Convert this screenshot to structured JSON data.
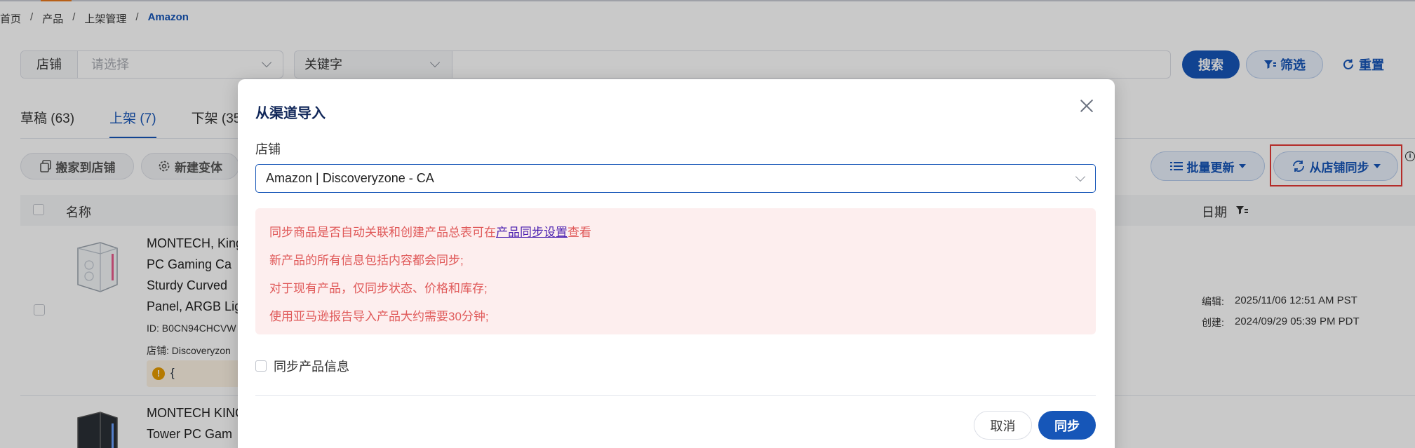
{
  "breadcrumb": [
    "首页",
    "产品",
    "上架管理",
    "Amazon"
  ],
  "filters": {
    "store_label": "店铺",
    "store_placeholder": "请选择",
    "keyword_label": "关键字",
    "search_button": "搜索",
    "filter_button": "筛选",
    "reset_button": "重置"
  },
  "tabs": [
    {
      "label": "草稿 (63)"
    },
    {
      "label": "上架 (7)",
      "active": true
    },
    {
      "label": "下架 (35"
    }
  ],
  "toolbar": {
    "move_button": "搬家到店铺",
    "variant_button": "新建变体",
    "batch_update_button": "批量更新",
    "sync_store_button": "从店铺同步"
  },
  "table": {
    "col_name": "名称",
    "col_date": "日期"
  },
  "rows": [
    {
      "title_lines": [
        "MONTECH, King",
        "PC Gaming Ca",
        "Sturdy Curved",
        "Panel, ARGB Lig"
      ],
      "id": "ID: B0CN94CHCVW",
      "store": "店铺: Discoveryzon",
      "warning": "{",
      "edit_label": "编辑:",
      "edit_date": "2025/11/06 12:51 AM PST",
      "create_label": "创建:",
      "create_date": "2024/09/29 05:39 PM PDT"
    },
    {
      "title_lines": [
        "MONTECH KING",
        "Tower PC Gam"
      ]
    }
  ],
  "modal": {
    "title": "从渠道导入",
    "store_label": "店铺",
    "store_value": "Amazon | Discoveryzone - CA",
    "notice_line1_prefix": "同步商品是否自动关联和创建产品总表可在",
    "notice_link": "产品同步设置",
    "notice_line1_suffix": "查看",
    "notice_line2": "新产品的所有信息包括内容都会同步;",
    "notice_line3": "对于现有产品，仅同步状态、价格和库存;",
    "notice_line4": "使用亚马逊报告导入产品大约需要30分钟;",
    "checkbox_label": "同步产品信息",
    "cancel_button": "取消",
    "sync_button": "同步"
  },
  "colors": {
    "primary": "#1656b8",
    "notice_bg": "#fdeeee",
    "notice_text": "#e05a5a",
    "highlight_border": "#e53935"
  }
}
